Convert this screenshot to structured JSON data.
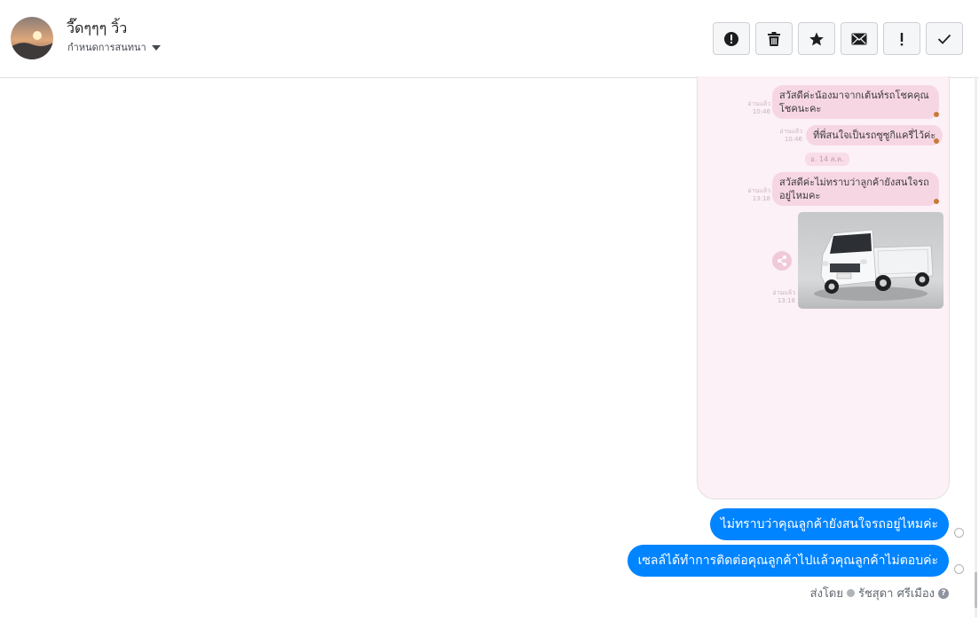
{
  "contact": {
    "name": "วี๊ดๆๆๆ วิ้ว",
    "dropdown_label": "กำหนดการสนทนา"
  },
  "toolbar": {
    "buttons": [
      {
        "name": "report-button",
        "icon": "alert-circle-icon"
      },
      {
        "name": "delete-button",
        "icon": "trash-icon"
      },
      {
        "name": "star-button",
        "icon": "star-icon"
      },
      {
        "name": "mail-button",
        "icon": "envelope-icon"
      },
      {
        "name": "exclaim-button",
        "icon": "exclamation-icon"
      },
      {
        "name": "done-button",
        "icon": "check-icon"
      }
    ]
  },
  "shared_screenshot": {
    "messages": [
      {
        "text": "สวัสดีค่ะน้องมาจากเต้นท์รถโชคคุณ\nโชคนะคะ",
        "meta": "อ่านแล้ว\n10:46"
      },
      {
        "text": "ที่พี่สนใจเป็นรถซูซูกิแครี่ไว้ค่ะ",
        "meta": "อ่านแล้ว\n10:46"
      },
      {
        "text": "สวัสดีค่ะไม่ทราบว่าลูกค้ายังสนใจรถ\nอยู่ไหมคะ",
        "meta": "อ่านแล้ว\n13:18"
      }
    ],
    "date_chip": "อ. 14 ส.ค.",
    "photo_meta": "อ่านแล้ว\n13:18"
  },
  "conversation": {
    "messages": [
      {
        "text": "ไม่ทราบว่าคุณลูกค้ายังสนใจรถอยู่ไหมค่ะ"
      },
      {
        "text": "เซลล์ได้ทำการติดต่อคุณลูกค้าไปแล้วคุณลูกค้าไม่ตอบค่ะ"
      }
    ],
    "sent_by_label": "ส่งโดย",
    "sender_name": "รัชสุดา ศรีเมือง"
  },
  "colors": {
    "bubble_blue": "#0084ff",
    "screenshot_bg": "#fcf1f6",
    "screenshot_bubble": "#f7d6e4"
  }
}
